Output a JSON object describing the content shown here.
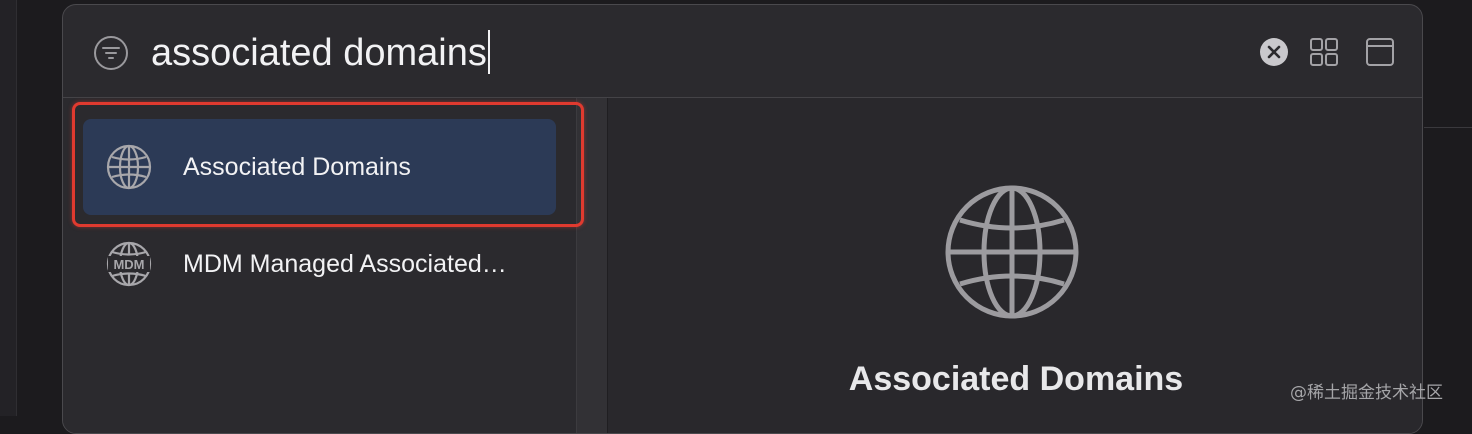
{
  "search": {
    "query": "associated domains",
    "icons": {
      "filter": "filter-icon",
      "clear": "clear-icon",
      "grid": "grid-view-icon",
      "window": "window-icon"
    }
  },
  "results": [
    {
      "label": "Associated Domains",
      "icon": "globe-icon",
      "selected": true
    },
    {
      "label": "MDM Managed Associated…",
      "icon": "mdm-globe-icon",
      "icon_text": "MDM",
      "selected": false
    }
  ],
  "detail": {
    "title": "Associated Domains",
    "icon": "globe-icon"
  },
  "watermark": "@稀土掘金技术社区",
  "colors": {
    "selection": "#2c3a56",
    "highlight": "#e03a2f",
    "panel": "#2b2a2e"
  }
}
